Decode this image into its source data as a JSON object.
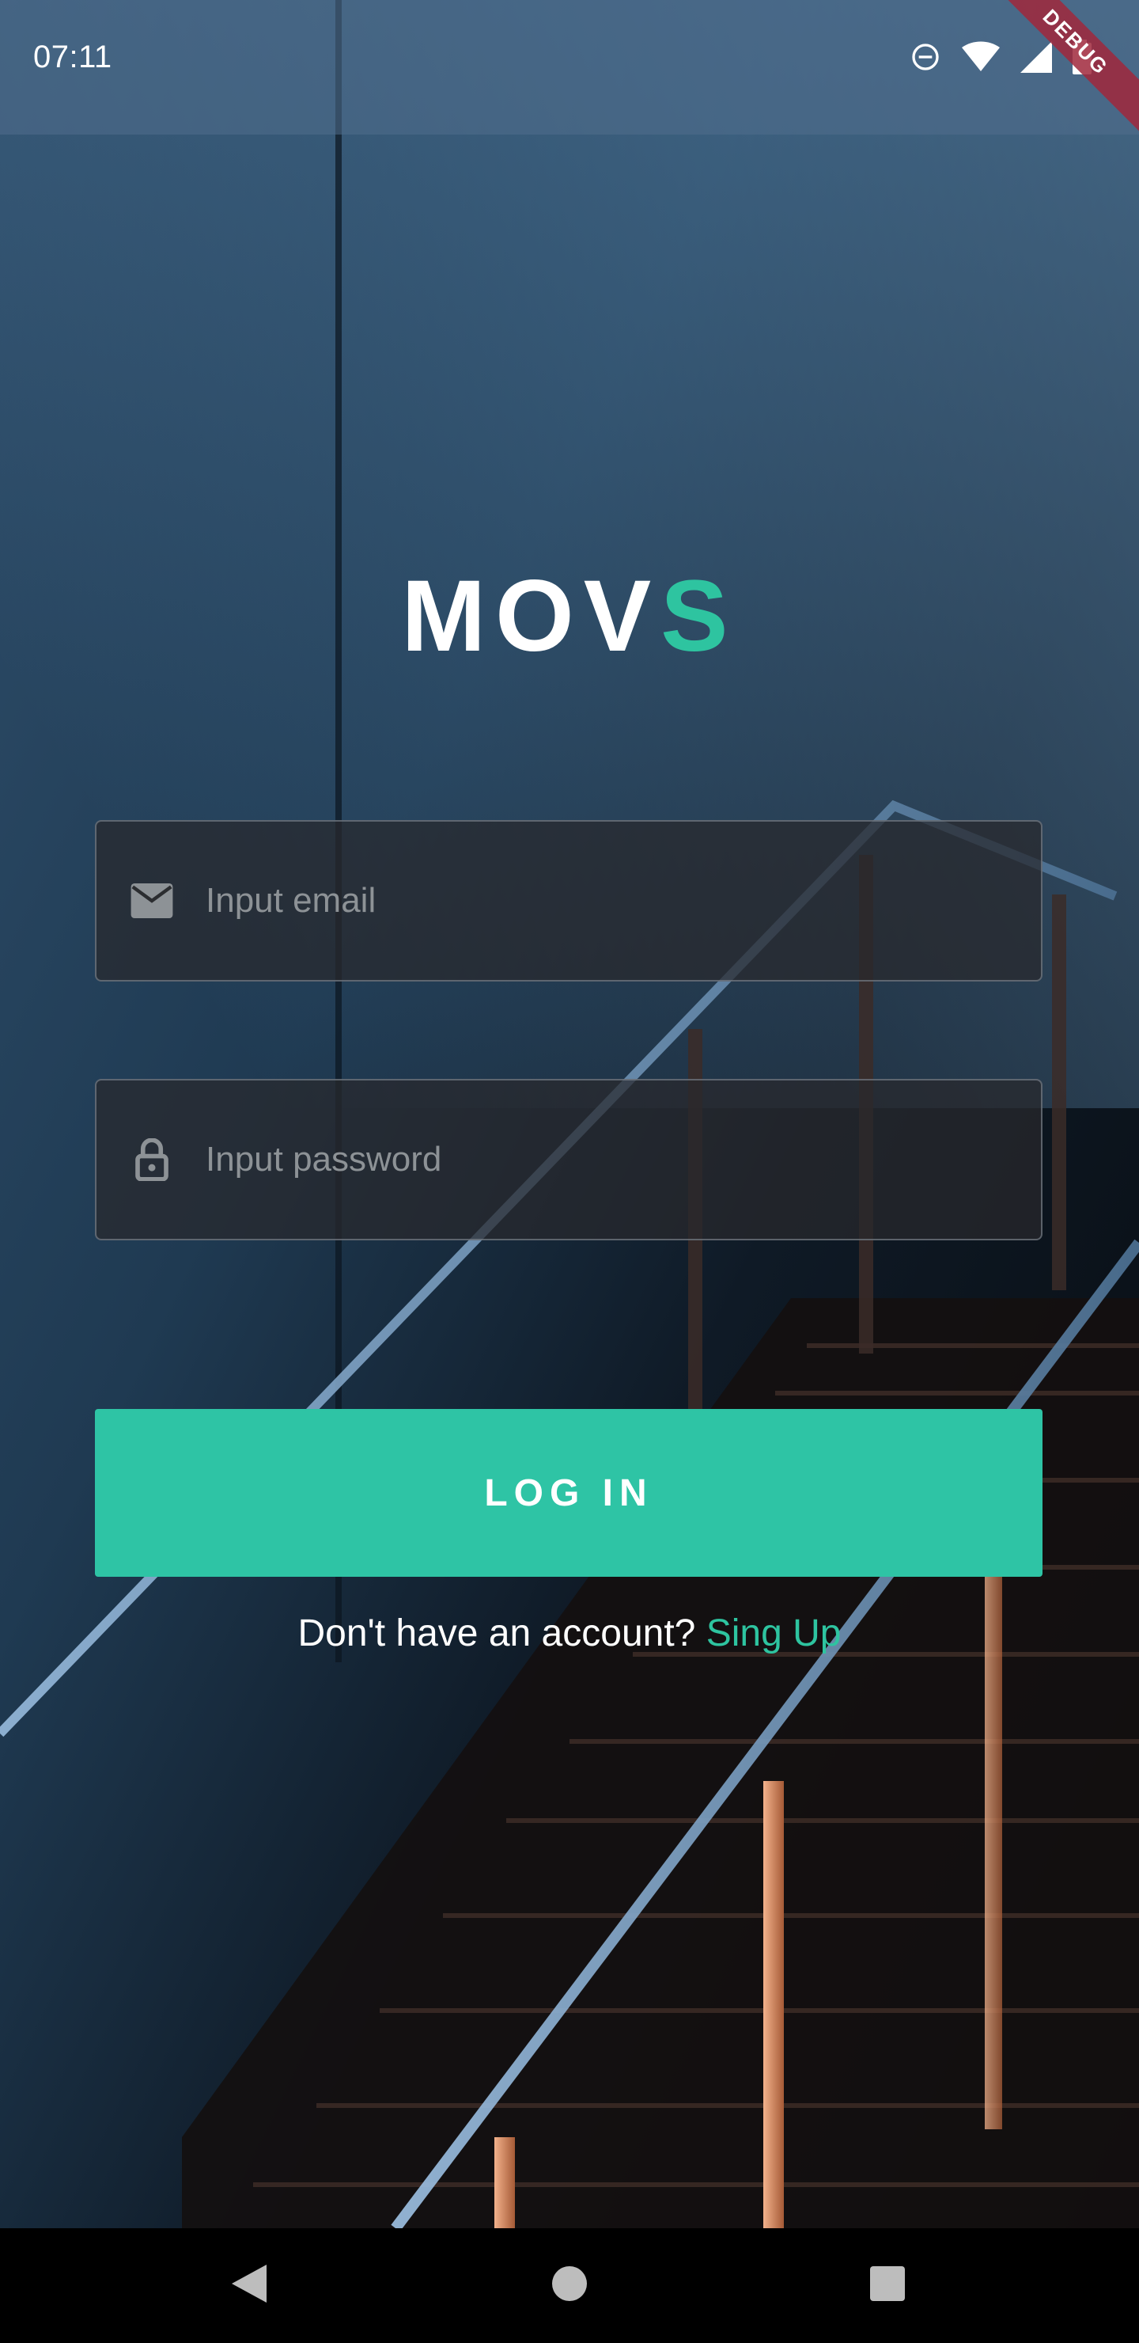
{
  "status_bar": {
    "time": "07:11",
    "icons": [
      "do-not-disturb-icon",
      "wifi-icon",
      "signal-icon",
      "battery-icon"
    ],
    "debug_label": "DEBUG"
  },
  "logo": {
    "main": "MOV",
    "accent": "S"
  },
  "email_field": {
    "placeholder": "Input email",
    "value": "",
    "icon": "mail-icon"
  },
  "password_field": {
    "placeholder": "Input password",
    "value": "",
    "icon": "lock-icon"
  },
  "login_button": {
    "label": "LOG IN"
  },
  "signup": {
    "prompt": "Don't have an account? ",
    "link": "Sing Up"
  },
  "nav_bar": {
    "buttons": [
      "back-icon",
      "home-icon",
      "recent-apps-icon"
    ]
  },
  "colors": {
    "accent": "#2ec4a5",
    "text": "#ffffff",
    "placeholder": "#8d9296"
  }
}
